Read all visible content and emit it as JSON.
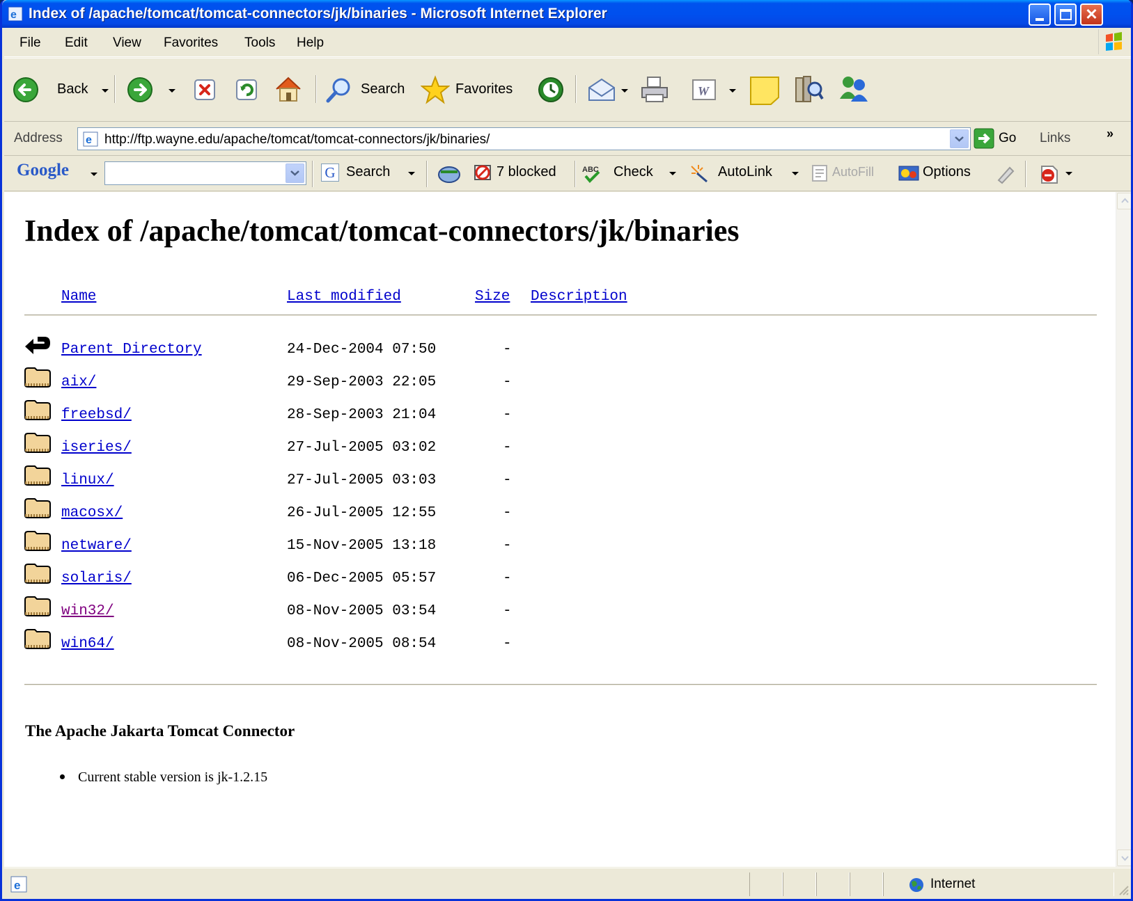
{
  "window": {
    "title": "Index of /apache/tomcat/tomcat-connectors/jk/binaries - Microsoft Internet Explorer"
  },
  "menu": {
    "items": [
      "File",
      "Edit",
      "View",
      "Favorites",
      "Tools",
      "Help"
    ]
  },
  "toolbar": {
    "back_label": "Back",
    "search_label": "Search",
    "favorites_label": "Favorites"
  },
  "address": {
    "label": "Address",
    "url": "http://ftp.wayne.edu/apache/tomcat/tomcat-connectors/jk/binaries/",
    "go_label": "Go",
    "links_label": "Links"
  },
  "googlebar": {
    "logo": "Google",
    "search_label": "Search",
    "blocked_label": "7 blocked",
    "check_label": "Check",
    "autolink_label": "AutoLink",
    "autofill_label": "AutoFill",
    "options_label": "Options"
  },
  "page": {
    "title": "Index of /apache/tomcat/tomcat-connectors/jk/binaries",
    "headers": {
      "name": "Name",
      "modified": "Last modified",
      "size": "Size",
      "description": "Description"
    },
    "entries": [
      {
        "name": "Parent Directory",
        "modified": "24-Dec-2004 07:50",
        "size": "-",
        "icon": "back-arrow-icon"
      },
      {
        "name": "aix/",
        "modified": "29-Sep-2003 22:05",
        "size": "-",
        "icon": "folder-icon"
      },
      {
        "name": "freebsd/",
        "modified": "28-Sep-2003 21:04",
        "size": "-",
        "icon": "folder-icon"
      },
      {
        "name": "iseries/",
        "modified": "27-Jul-2005 03:02",
        "size": "-",
        "icon": "folder-icon"
      },
      {
        "name": "linux/",
        "modified": "27-Jul-2005 03:03",
        "size": "-",
        "icon": "folder-icon"
      },
      {
        "name": "macosx/",
        "modified": "26-Jul-2005 12:55",
        "size": "-",
        "icon": "folder-icon"
      },
      {
        "name": "netware/",
        "modified": "15-Nov-2005 13:18",
        "size": "-",
        "icon": "folder-icon"
      },
      {
        "name": "solaris/",
        "modified": "06-Dec-2005 05:57",
        "size": "-",
        "icon": "folder-icon"
      },
      {
        "name": "win32/",
        "modified": "08-Nov-2005 03:54",
        "size": "-",
        "icon": "folder-icon"
      },
      {
        "name": "win64/",
        "modified": "08-Nov-2005 08:54",
        "size": "-",
        "icon": "folder-icon"
      }
    ],
    "footer_heading": "The Apache Jakarta Tomcat Connector",
    "footer_items": [
      "Current stable version is jk-1.2.15"
    ]
  },
  "status": {
    "zone": "Internet"
  },
  "colors": {
    "link": "#0000cc",
    "visited_link": "#800080",
    "titlebar": "#0053ee"
  }
}
